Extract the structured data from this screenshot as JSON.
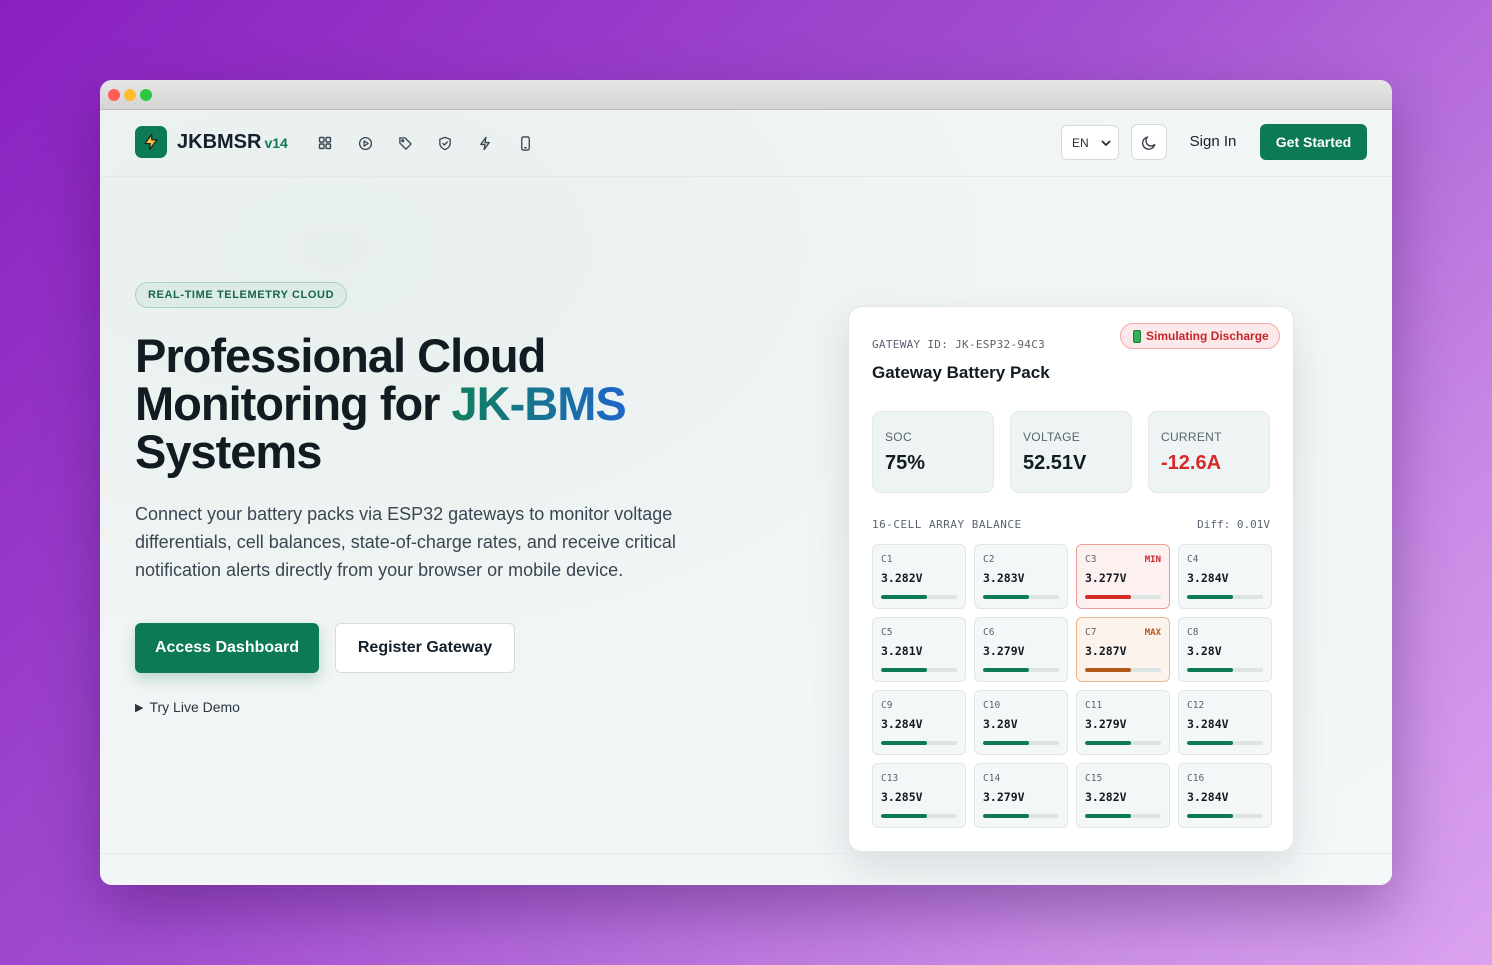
{
  "brand": {
    "name": "JKBMSR",
    "version": "v14"
  },
  "nav": {
    "icons": [
      "grid-icon",
      "play-circle-icon",
      "tag-icon",
      "shield-icon",
      "bolt-icon",
      "mobile-icon"
    ],
    "language": "EN",
    "sign_in": "Sign In",
    "get_started": "Get Started"
  },
  "hero": {
    "pill": "REAL-TIME TELEMETRY CLOUD",
    "headline_1": "Professional Cloud Monitoring for ",
    "headline_accent": "JK-BMS",
    "headline_2": " Systems",
    "description": "Connect your battery packs via ESP32 gateways to monitor voltage differentials, cell balances, state-of-charge rates, and receive critical notification alerts directly from your browser or mobile device.",
    "primary_button": "Access Dashboard",
    "secondary_button": "Register Gateway",
    "demo_link": "Try Live Demo"
  },
  "card": {
    "gateway_id": "GATEWAY ID: JK-ESP32-94C3",
    "title": "Gateway Battery Pack",
    "status_badge": "Simulating Discharge",
    "stats": [
      {
        "label": "SOC",
        "value": "75%"
      },
      {
        "label": "VOLTAGE",
        "value": "52.51V"
      },
      {
        "label": "CURRENT",
        "value": "-12.6A"
      }
    ],
    "section_label": "16-CELL ARRAY BALANCE",
    "diff": "Diff: 0.01V",
    "cells": [
      {
        "name": "C1",
        "value": "3.282V",
        "tag": "",
        "state": "",
        "level": 0.6
      },
      {
        "name": "C2",
        "value": "3.283V",
        "tag": "",
        "state": "",
        "level": 0.6
      },
      {
        "name": "C3",
        "value": "3.277V",
        "tag": "MIN",
        "state": "min",
        "level": 0.6
      },
      {
        "name": "C4",
        "value": "3.284V",
        "tag": "",
        "state": "",
        "level": 0.6
      },
      {
        "name": "C5",
        "value": "3.281V",
        "tag": "",
        "state": "",
        "level": 0.6
      },
      {
        "name": "C6",
        "value": "3.279V",
        "tag": "",
        "state": "",
        "level": 0.6
      },
      {
        "name": "C7",
        "value": "3.287V",
        "tag": "MAX",
        "state": "max",
        "level": 0.6
      },
      {
        "name": "C8",
        "value": "3.28V",
        "tag": "",
        "state": "",
        "level": 0.6
      },
      {
        "name": "C9",
        "value": "3.284V",
        "tag": "",
        "state": "",
        "level": 0.6
      },
      {
        "name": "C10",
        "value": "3.28V",
        "tag": "",
        "state": "",
        "level": 0.6
      },
      {
        "name": "C11",
        "value": "3.279V",
        "tag": "",
        "state": "",
        "level": 0.6
      },
      {
        "name": "C12",
        "value": "3.284V",
        "tag": "",
        "state": "",
        "level": 0.6
      },
      {
        "name": "C13",
        "value": "3.285V",
        "tag": "",
        "state": "",
        "level": 0.6
      },
      {
        "name": "C14",
        "value": "3.279V",
        "tag": "",
        "state": "",
        "level": 0.6
      },
      {
        "name": "C15",
        "value": "3.282V",
        "tag": "",
        "state": "",
        "level": 0.6
      },
      {
        "name": "C16",
        "value": "3.284V",
        "tag": "",
        "state": "",
        "level": 0.6
      }
    ]
  },
  "colors": {
    "brand_green": "#0b7a55",
    "accent_blue": "#1f66c9",
    "danger_red": "#d42a2a",
    "warning_orange": "#b4581a"
  }
}
